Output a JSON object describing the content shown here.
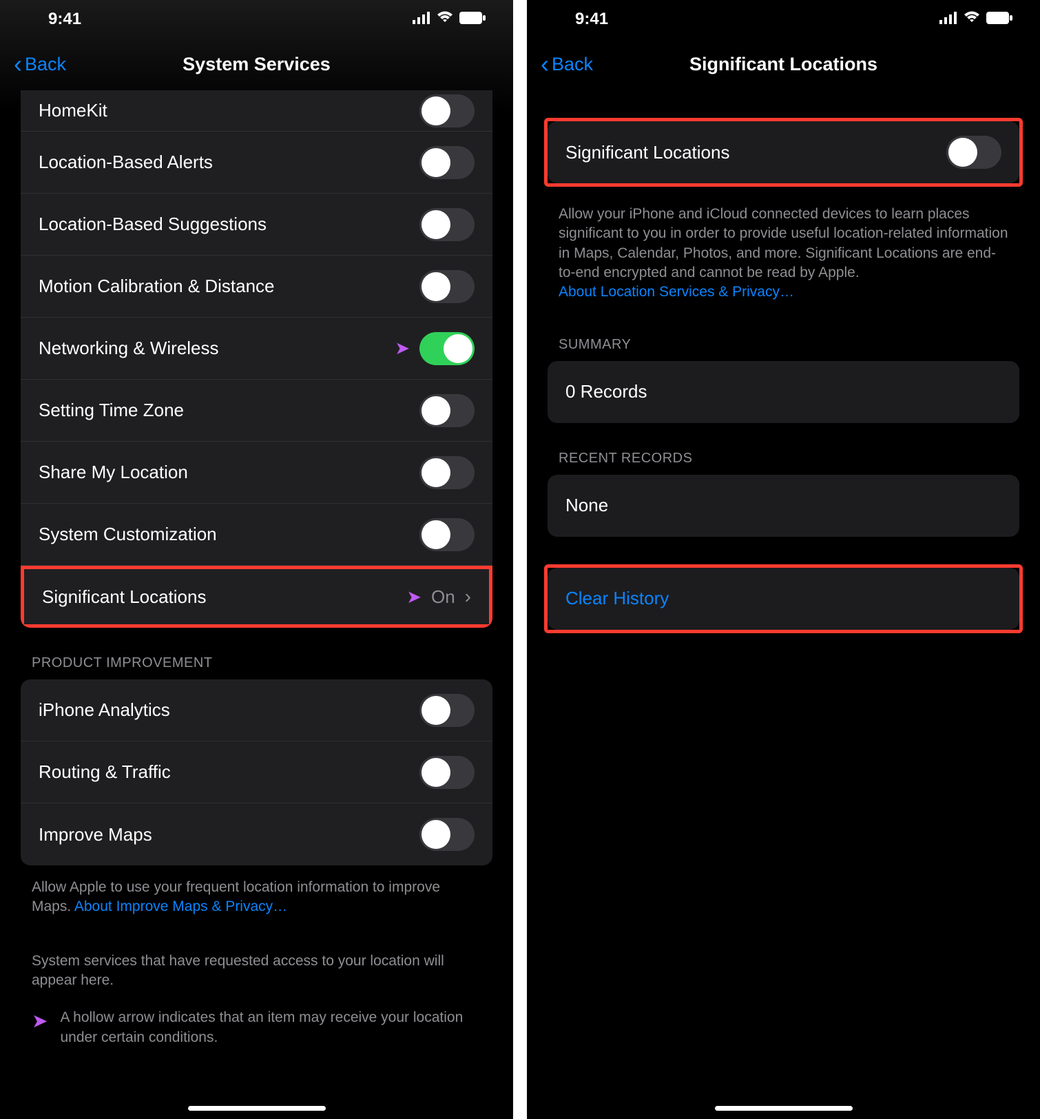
{
  "status": {
    "time": "9:41"
  },
  "left": {
    "back": "Back",
    "title": "System Services",
    "rows_top": [
      {
        "label": "HomeKit",
        "toggle": "off"
      },
      {
        "label": "Location-Based Alerts",
        "toggle": "off"
      },
      {
        "label": "Location-Based Suggestions",
        "toggle": "off"
      },
      {
        "label": "Motion Calibration & Distance",
        "toggle": "off"
      },
      {
        "label": "Networking & Wireless",
        "toggle": "on",
        "arrow": true
      },
      {
        "label": "Setting Time Zone",
        "toggle": "off"
      },
      {
        "label": "Share My Location",
        "toggle": "off"
      },
      {
        "label": "System Customization",
        "toggle": "off"
      }
    ],
    "sig_loc": {
      "label": "Significant Locations",
      "value": "On"
    },
    "section_product": "PRODUCT IMPROVEMENT",
    "rows_product": [
      {
        "label": "iPhone Analytics",
        "toggle": "off"
      },
      {
        "label": "Routing & Traffic",
        "toggle": "off"
      },
      {
        "label": "Improve Maps",
        "toggle": "off"
      }
    ],
    "footer1_a": "Allow Apple to use your frequent location information to improve Maps. ",
    "footer1_link": "About Improve Maps & Privacy…",
    "footer2": "System services that have requested access to your location will appear here.",
    "footer3": "A hollow arrow indicates that an item may receive your location under certain conditions."
  },
  "right": {
    "back": "Back",
    "title": "Significant Locations",
    "toggle_label": "Significant Locations",
    "desc": "Allow your iPhone and iCloud connected devices to learn places significant to you in order to provide useful location-related information in Maps, Calendar, Photos, and more. Significant Locations are end-to-end encrypted and cannot be read by Apple.",
    "desc_link": "About Location Services & Privacy…",
    "summary_header": "SUMMARY",
    "summary_value": "0 Records",
    "recent_header": "RECENT RECORDS",
    "recent_value": "None",
    "clear": "Clear History"
  }
}
